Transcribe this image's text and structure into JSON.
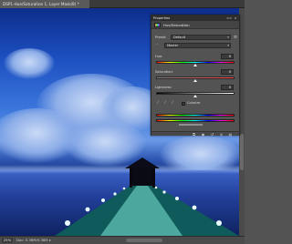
{
  "document": {
    "tab_title": "DSP1-Hue/Saturation 1, Layer Mask/8) *"
  },
  "properties_panel": {
    "title": "Properties",
    "close_label": "x",
    "collapse_label": "<<",
    "adjustment_title": "Hue/Saturation",
    "preset_label": "Preset:",
    "preset_value": "Default",
    "channel_value": "Master",
    "hue_label": "Hue:",
    "hue_value": "0",
    "hue_level": 0.5,
    "saturation_label": "Saturation:",
    "saturation_value": "0",
    "saturation_level": 0.5,
    "lightness_label": "Lightness:",
    "lightness_value": "0",
    "lightness_level": 0.5,
    "colorize_label": "Colorize"
  },
  "status_bar": {
    "zoom": "25%",
    "doc_info": "Doc: 5.36M/5.38M"
  },
  "icons": {
    "adjustment": "hue-saturation-icon",
    "panel_menu": "panel-menu-icon",
    "hand_tool": "targeted-adjustment-icon",
    "eyedroppers": [
      "eyedropper-icon",
      "eyedropper-plus-icon",
      "eyedropper-minus-icon"
    ],
    "footer": [
      "clip-to-layer-icon",
      "view-previous-icon",
      "reset-icon",
      "visibility-icon",
      "trash-icon"
    ]
  },
  "colors": {
    "panel_bg": "#535353",
    "title_bar": "#2e2e2e",
    "workspace": "#535353"
  }
}
